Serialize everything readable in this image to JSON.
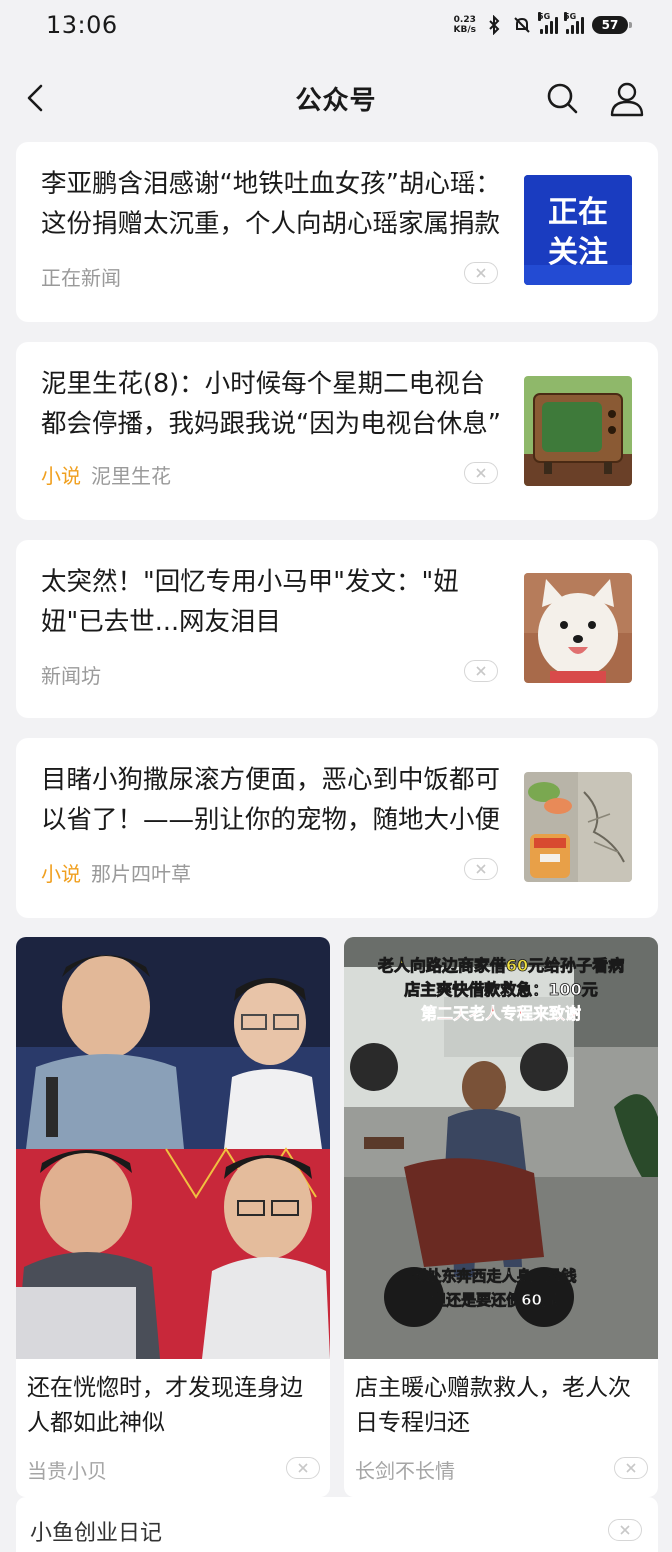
{
  "status_bar": {
    "time": "13:06",
    "net_speed_value": "0.23",
    "net_speed_unit": "KB/s",
    "signal_1": "5G",
    "signal_2": "5G",
    "battery": "57"
  },
  "nav": {
    "title": "公众号",
    "back_icon": "chevron-left-icon",
    "search_icon": "search-icon",
    "profile_icon": "user-icon"
  },
  "articles": [
    {
      "title": "李亚鹏含泪感谢“地铁吐血女孩”胡心瑶：这份捐赠太沉重，个人向胡心瑶家属捐款",
      "tag": "",
      "source": "正在新闻",
      "thumb_text_1": "正在",
      "thumb_text_2": "关注"
    },
    {
      "title": "泥里生花(8)：小时候每个星期二电视台都会停播，我妈跟我说“因为电视台休息”",
      "tag": "小说",
      "source": "泥里生花"
    },
    {
      "title": "太突然！\"回忆专用小马甲\"发文：\"妞妞\"已去世...网友泪目",
      "tag": "",
      "source": "新闻坊"
    },
    {
      "title": "目睹小狗撒尿滚方便面，恶心到中饭都可以省了！——别让你的宠物，随地大小便",
      "tag": "小说",
      "source": "那片四叶草"
    }
  ],
  "grid_items": [
    {
      "title": "还在恍惚时，才发现连身边人都如此神似",
      "author": "当贵小贝"
    },
    {
      "title": "店主暖心赠款救人，老人次日专程归还",
      "author": "长剑不长情",
      "caption_1": "老人向路边商家借60元给孙子看病",
      "caption_2": "店主爽快借款救急：100元",
      "caption_3": "第二天老人专程来致谢",
      "caption_4": "到处东奔西走人身上没钱",
      "caption_5": "但还是要还债60元"
    }
  ],
  "bottom_item": {
    "title": "小鱼创业日记"
  },
  "colors": {
    "background": "#f2f2f4",
    "tag": "#f0a020",
    "muted": "#9a9a9a"
  }
}
